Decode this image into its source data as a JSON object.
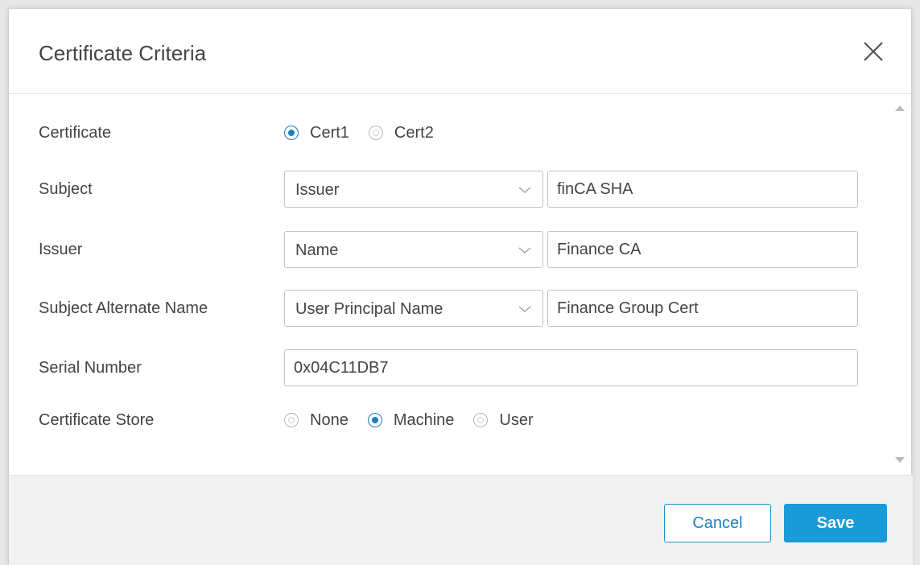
{
  "dialog": {
    "title": "Certificate Criteria"
  },
  "form": {
    "certificate": {
      "label": "Certificate",
      "options": [
        "Cert1",
        "Cert2"
      ],
      "selected": "Cert1"
    },
    "subject": {
      "label": "Subject",
      "select_value": "Issuer",
      "input_value": "finCA SHA"
    },
    "issuer": {
      "label": "Issuer",
      "select_value": "Name",
      "input_value": "Finance CA"
    },
    "san": {
      "label": "Subject Alternate Name",
      "select_value": "User Principal Name",
      "input_value": "Finance Group Cert"
    },
    "serial": {
      "label": "Serial Number",
      "input_value": "0x04C11DB7"
    },
    "store": {
      "label": "Certificate Store",
      "options": [
        "None",
        "Machine",
        "User"
      ],
      "selected": "Machine"
    }
  },
  "footer": {
    "cancel_label": "Cancel",
    "save_label": "Save"
  },
  "colors": {
    "accent": "#1a9ad6",
    "radio_checked": "#1e7fc0"
  },
  "icons": {
    "close": "close-icon",
    "dropdown": "chevron-down-icon",
    "scroll_up": "scroll-up-arrow-icon",
    "scroll_down": "scroll-down-arrow-icon"
  }
}
